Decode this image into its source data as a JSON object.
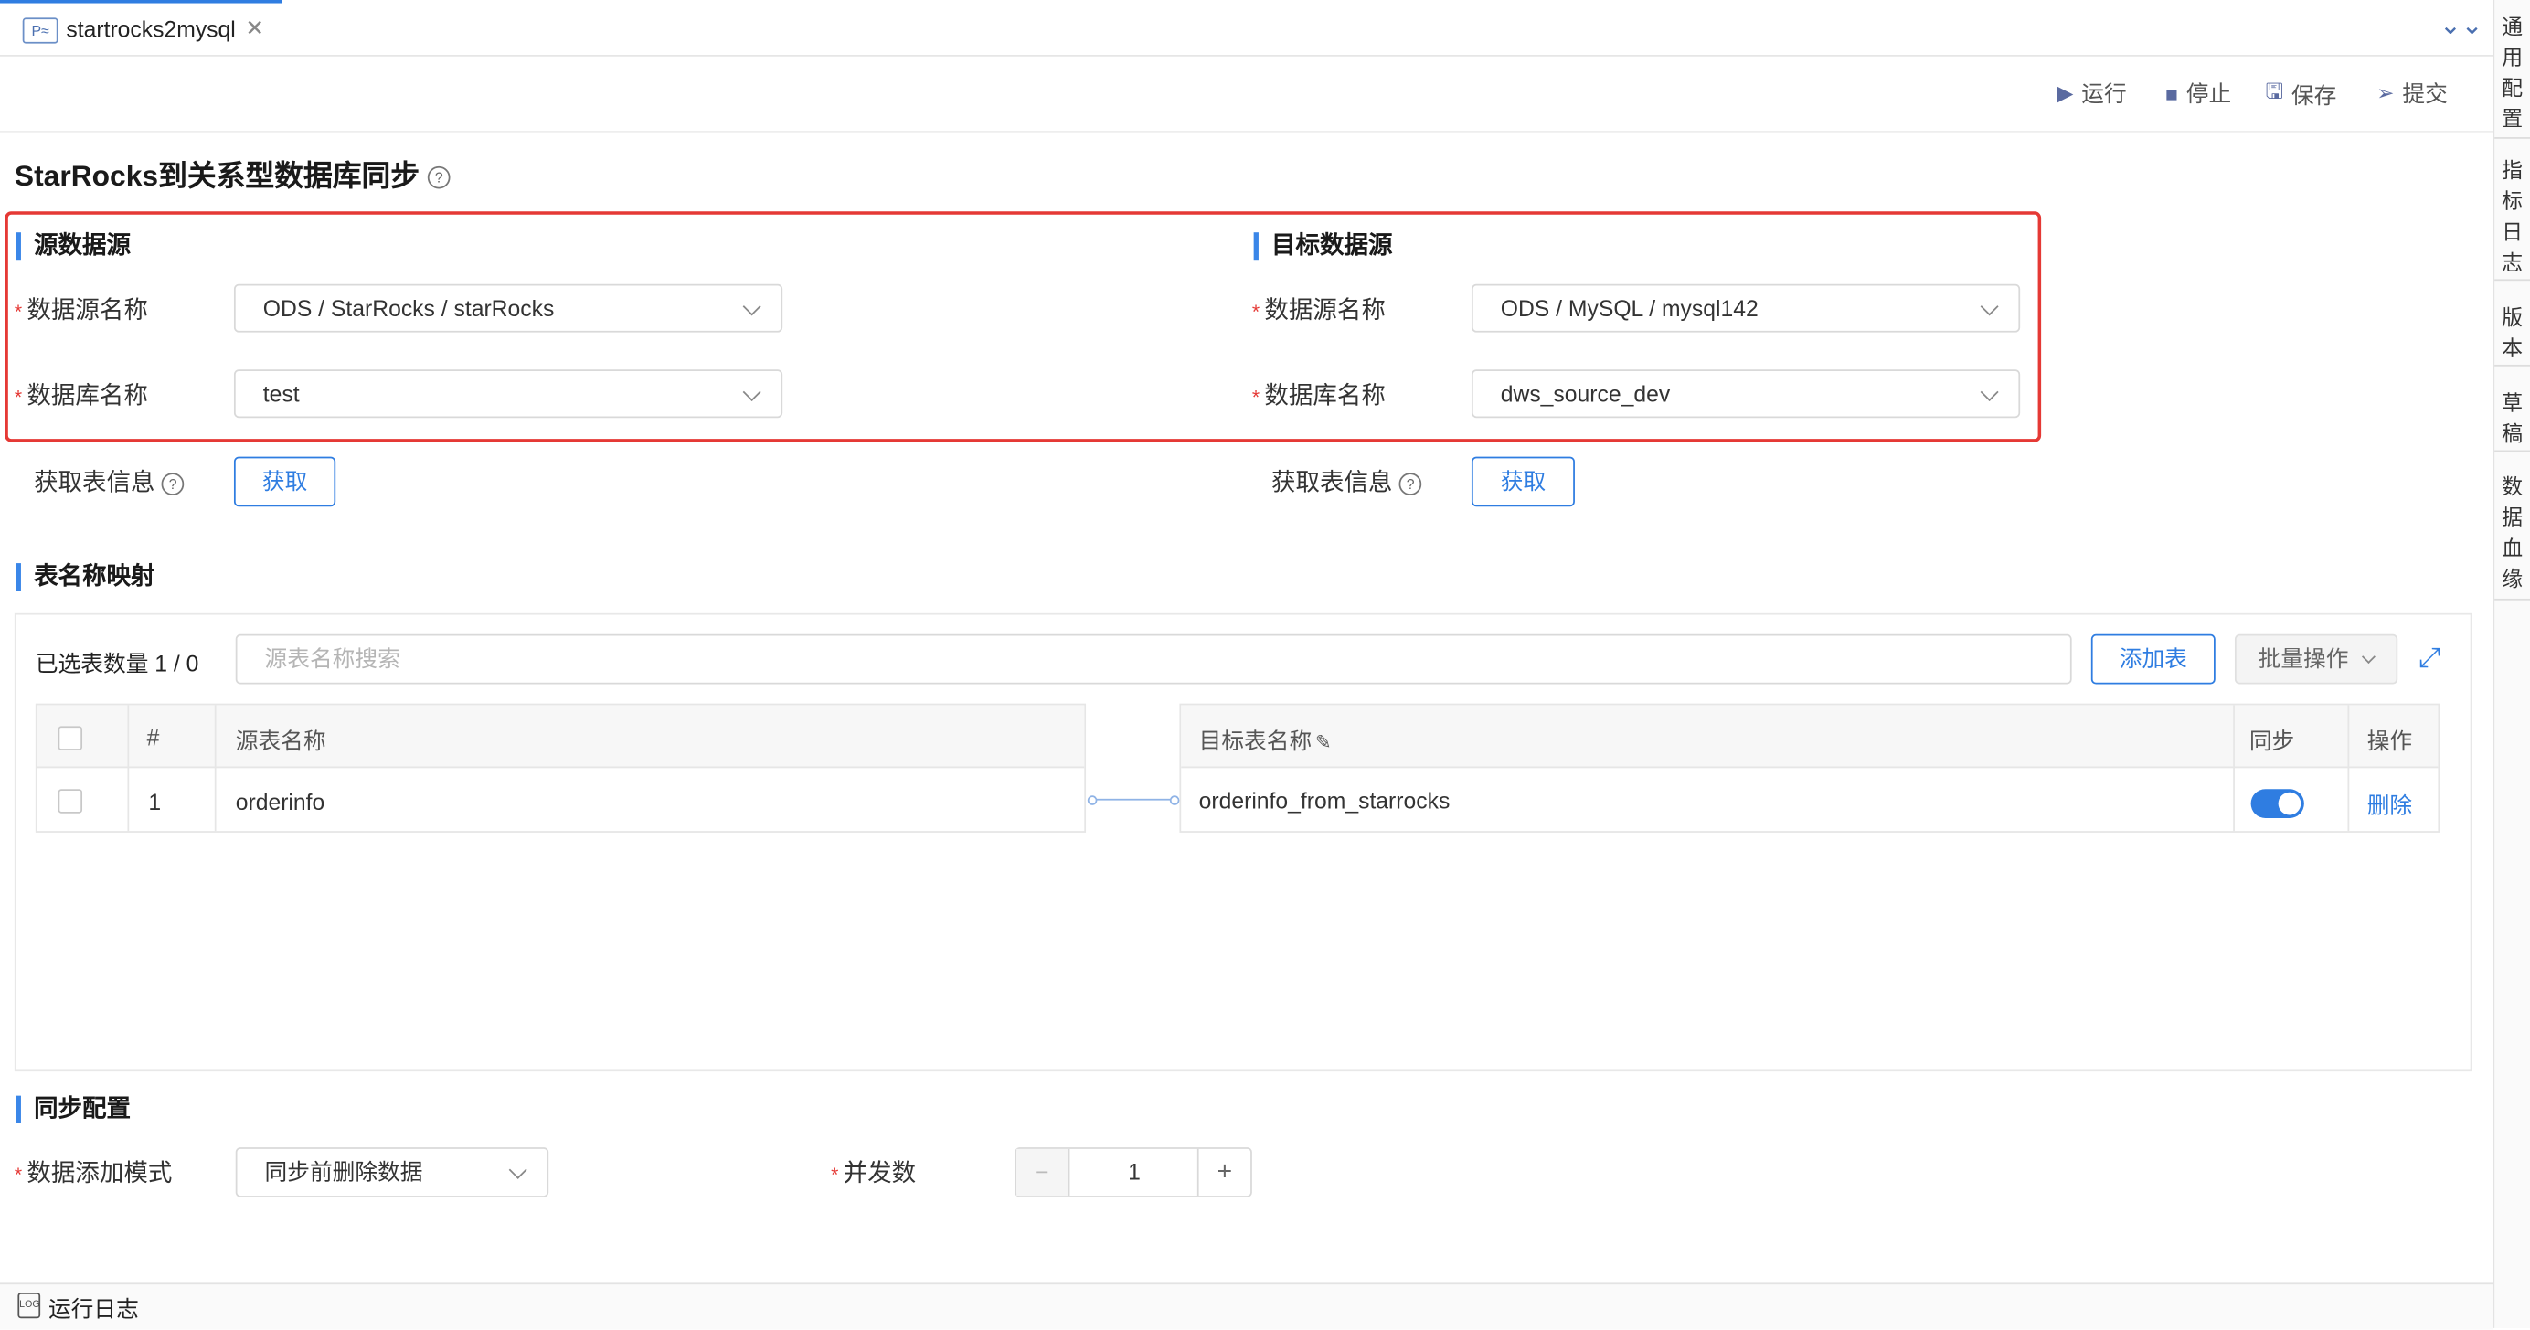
{
  "tab": {
    "icon": "P≈",
    "title": "startrocks2mysql",
    "close": "✕"
  },
  "collapse_icon": "⌄⌄",
  "side_panel": [
    "通用配置",
    "指标日志",
    "版本",
    "草稿",
    "数据血缘"
  ],
  "toolbar": {
    "run": "运行",
    "stop": "停止",
    "save": "保存",
    "submit": "提交"
  },
  "page_title": "StarRocks到关系型数据库同步",
  "source": {
    "title": "源数据源",
    "datasource_label": "数据源名称",
    "datasource_value": "ODS / StarRocks / starRocks",
    "database_label": "数据库名称",
    "database_value": "test",
    "fetch_label": "获取表信息",
    "fetch_button": "获取"
  },
  "target": {
    "title": "目标数据源",
    "datasource_label": "数据源名称",
    "datasource_value": "ODS / MySQL / mysql142",
    "database_label": "数据库名称",
    "database_value": "dws_source_dev",
    "fetch_label": "获取表信息",
    "fetch_button": "获取"
  },
  "mapping": {
    "title": "表名称映射",
    "selected_count": "已选表数量 1 / 0",
    "search_placeholder": "源表名称搜索",
    "add_table": "添加表",
    "batch_ops": "批量操作",
    "source_headers": {
      "index": "#",
      "name": "源表名称"
    },
    "target_headers": {
      "name": "目标表名称",
      "sync": "同步",
      "action": "操作"
    },
    "rows": [
      {
        "index": "1",
        "source": "orderinfo",
        "target": "orderinfo_from_starrocks",
        "sync": true,
        "action": "删除"
      }
    ]
  },
  "sync_config": {
    "title": "同步配置",
    "mode_label": "数据添加模式",
    "mode_value": "同步前删除数据",
    "concurrency_label": "并发数",
    "concurrency_value": "1",
    "minus": "−",
    "plus": "+"
  },
  "bottom": {
    "log_label": "运行日志",
    "log_icon": "LOG"
  },
  "colors": {
    "accent": "#2f7de1",
    "highlight_border": "#e53935",
    "required": "#e53935"
  }
}
